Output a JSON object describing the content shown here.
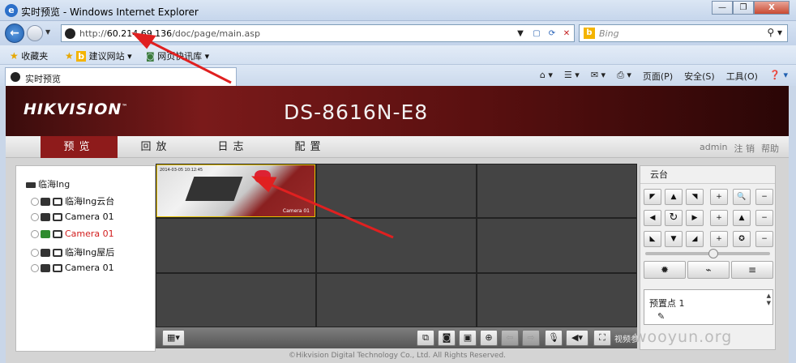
{
  "browser": {
    "window_title": "实时预览 - Windows Internet Explorer",
    "url_host": "60.214.69.136",
    "url_scheme": "http://",
    "url_path": "/doc/page/main.asp",
    "search_placeholder": "Bing",
    "favorites_label": "收藏夹",
    "fav_suggest": "建议网站",
    "fav_gallery": "网页快讯库",
    "tab_title": "实时预览",
    "commands": [
      "页面(P)",
      "安全(S)",
      "工具(O)"
    ],
    "window_buttons": {
      "minimize": "—",
      "restore": "❐",
      "close": "X"
    }
  },
  "app": {
    "brand": "HIKVISION",
    "brand_tm": "™",
    "model": "DS-8616N-E8",
    "menu": [
      "预览",
      "回放",
      "日志",
      "配置"
    ],
    "active_menu": 0,
    "user": "admin",
    "logout": "注 销",
    "help": "帮助",
    "footer": "©Hikvision Digital Technology Co., Ltd. All Rights Reserved."
  },
  "tree": {
    "root": "临海Ing",
    "items": [
      {
        "label": "临海Ing云台",
        "active": false
      },
      {
        "label": "Camera 01",
        "active": false
      },
      {
        "label": "Camera 01",
        "active": true
      },
      {
        "label": "临海Ing屋后",
        "active": false
      },
      {
        "label": "Camera 01",
        "active": false
      }
    ]
  },
  "video": {
    "overlay_timestamp": "2014-03-05 10:12:45",
    "overlay_camera": "Camera 01"
  },
  "ptz": {
    "title": "云台",
    "preset_label": "预置点",
    "preset_value": "1"
  },
  "watermark": "wooyun.org",
  "toolbar_partial_text": "视频参数"
}
